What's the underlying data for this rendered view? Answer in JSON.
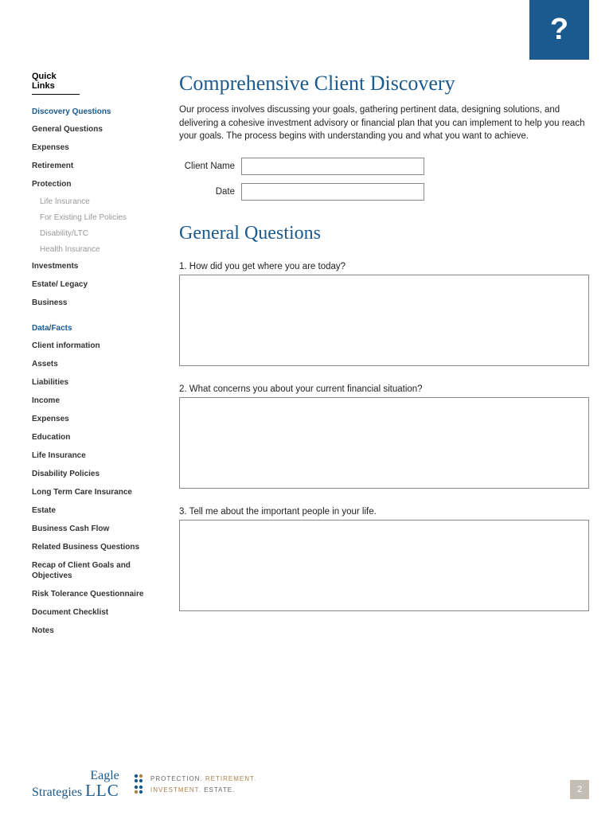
{
  "helpIcon": "?",
  "sidebar": {
    "quickLinks": "Quick Links",
    "section1": {
      "header": "Discovery Questions",
      "items": [
        "General Questions",
        "Expenses",
        "Retirement",
        "Protection"
      ],
      "protectionSubs": [
        "Life Insurance",
        "For Existing Life Policies",
        "Disability/LTC",
        "Health Insurance"
      ],
      "items2": [
        "Investments",
        "Estate/ Legacy",
        "Business"
      ]
    },
    "section2": {
      "header": "Data/Facts",
      "items": [
        "Client information",
        "Assets",
        "Liabilities",
        "Income",
        "Expenses",
        "Education",
        "Life Insurance",
        "Disability Policies",
        "Long Term Care Insurance",
        "Estate",
        "Business Cash Flow",
        "Related Business Questions",
        "Recap of Client Goals and Objectives",
        "Risk Tolerance Questionnaire",
        "Document Checklist",
        "Notes"
      ]
    }
  },
  "main": {
    "title": "Comprehensive Client Discovery",
    "intro": "Our process involves discussing your goals, gathering pertinent data, designing solutions, and delivering a cohesive investment advisory or financial plan that you can implement to help you reach your goals. The process begins with understanding you and what you want to achieve.",
    "clientNameLabel": "Client Name",
    "dateLabel": "Date",
    "sectionTitle": "General Questions",
    "q1": "1. How did you get where you are today?",
    "q2": "2. What concerns you about your current financial situation?",
    "q3": "3. Tell me about the important people in your life."
  },
  "footer": {
    "logoTop": "Eagle",
    "logoBottom": "Strategies",
    "logoLLC": "LLC",
    "tag1a": "PROTECTION.",
    "tag1b": "RETIREMENT.",
    "tag2a": "INVESTMENT.",
    "tag2b": "ESTATE.",
    "pageNum": "2"
  }
}
